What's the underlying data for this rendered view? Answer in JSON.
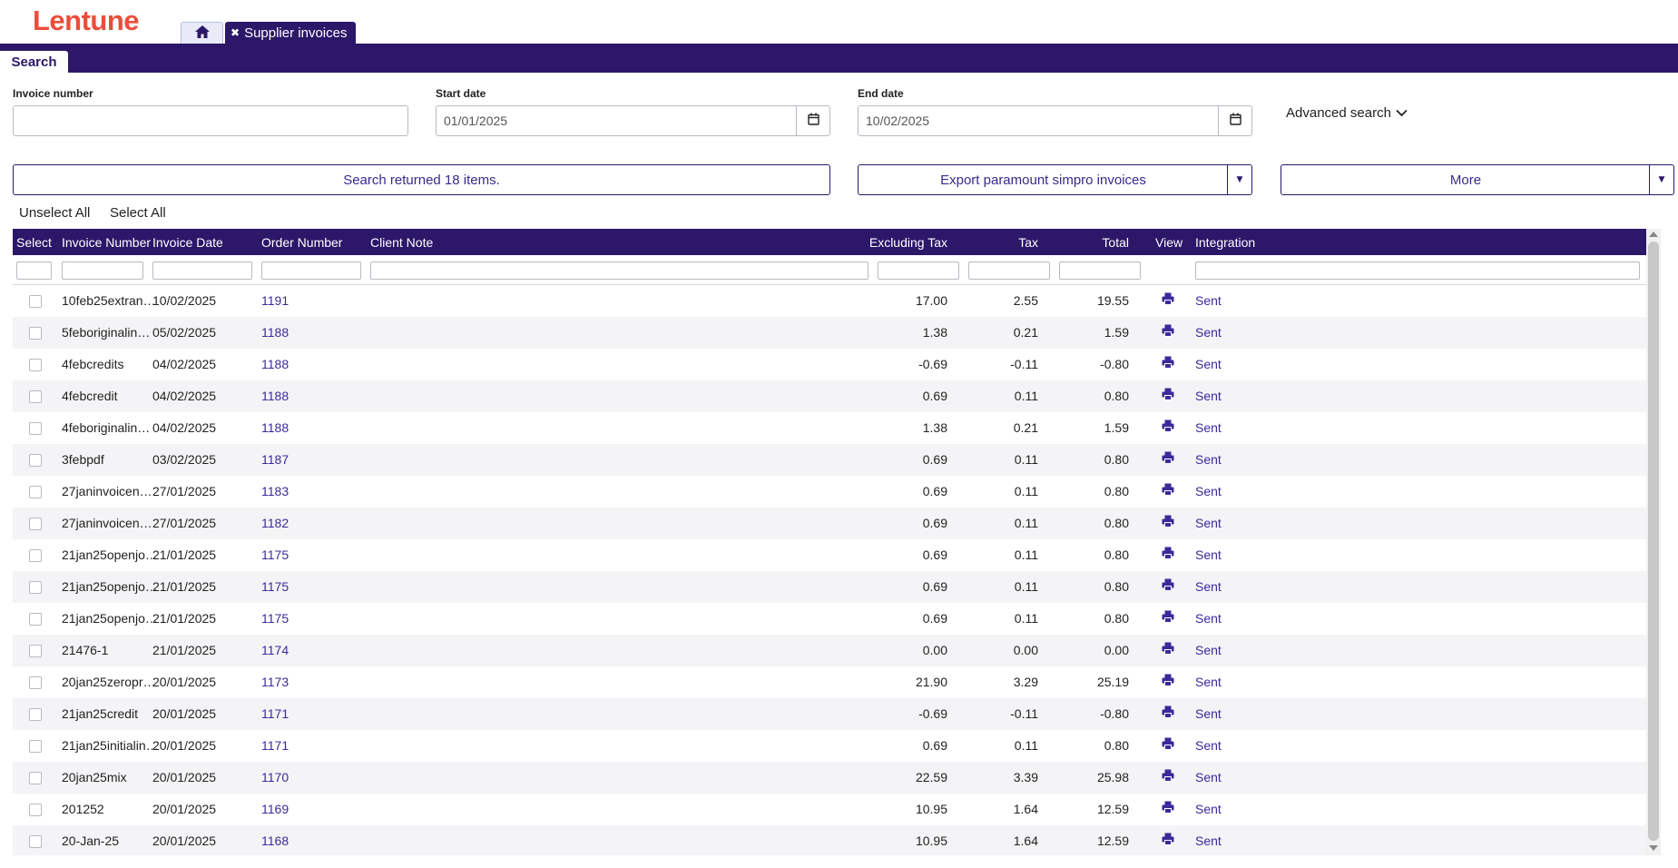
{
  "app": {
    "logo": "Lentune",
    "home_tab_icon": "home-icon",
    "active_tab": "Supplier invoices",
    "active_tab_close": "✖",
    "section_tab": "Search",
    "accent_color": "#2c1769",
    "logo_color": "#ec4d3a"
  },
  "filters": {
    "invoice_number_label": "Invoice number",
    "invoice_number_value": "",
    "start_date_label": "Start date",
    "start_date_value": "01/01/2025",
    "end_date_label": "End date",
    "end_date_value": "10/02/2025",
    "advanced_search": "Advanced search"
  },
  "actions": {
    "search_result": "Search returned 18 items.",
    "export": "Export paramount simpro invoices",
    "more": "More",
    "unselect_all": "Unselect All",
    "select_all": "Select All"
  },
  "grid": {
    "columns": [
      "Select",
      "Invoice Number",
      "Invoice Date",
      "Order Number",
      "Client Note",
      "Excluding Tax",
      "Tax",
      "Total",
      "View",
      "Integration"
    ],
    "rows": [
      {
        "invoice": "10feb25extran…",
        "date": "10/02/2025",
        "order": "1191",
        "note": "",
        "ex_tax": "17.00",
        "tax": "2.55",
        "total": "19.55",
        "integration": "Sent"
      },
      {
        "invoice": "5feboriginalin…",
        "date": "05/02/2025",
        "order": "1188",
        "note": "",
        "ex_tax": "1.38",
        "tax": "0.21",
        "total": "1.59",
        "integration": "Sent"
      },
      {
        "invoice": "4febcredits",
        "date": "04/02/2025",
        "order": "1188",
        "note": "",
        "ex_tax": "-0.69",
        "tax": "-0.11",
        "total": "-0.80",
        "integration": "Sent"
      },
      {
        "invoice": "4febcredit",
        "date": "04/02/2025",
        "order": "1188",
        "note": "",
        "ex_tax": "0.69",
        "tax": "0.11",
        "total": "0.80",
        "integration": "Sent"
      },
      {
        "invoice": "4feboriginalin…",
        "date": "04/02/2025",
        "order": "1188",
        "note": "",
        "ex_tax": "1.38",
        "tax": "0.21",
        "total": "1.59",
        "integration": "Sent"
      },
      {
        "invoice": "3febpdf",
        "date": "03/02/2025",
        "order": "1187",
        "note": "",
        "ex_tax": "0.69",
        "tax": "0.11",
        "total": "0.80",
        "integration": "Sent"
      },
      {
        "invoice": "27janinvoicen…",
        "date": "27/01/2025",
        "order": "1183",
        "note": "",
        "ex_tax": "0.69",
        "tax": "0.11",
        "total": "0.80",
        "integration": "Sent"
      },
      {
        "invoice": "27janinvoicen…",
        "date": "27/01/2025",
        "order": "1182",
        "note": "",
        "ex_tax": "0.69",
        "tax": "0.11",
        "total": "0.80",
        "integration": "Sent"
      },
      {
        "invoice": "21jan25openjo…",
        "date": "21/01/2025",
        "order": "1175",
        "note": "",
        "ex_tax": "0.69",
        "tax": "0.11",
        "total": "0.80",
        "integration": "Sent"
      },
      {
        "invoice": "21jan25openjo…",
        "date": "21/01/2025",
        "order": "1175",
        "note": "",
        "ex_tax": "0.69",
        "tax": "0.11",
        "total": "0.80",
        "integration": "Sent"
      },
      {
        "invoice": "21jan25openjo…",
        "date": "21/01/2025",
        "order": "1175",
        "note": "",
        "ex_tax": "0.69",
        "tax": "0.11",
        "total": "0.80",
        "integration": "Sent"
      },
      {
        "invoice": "21476-1",
        "date": "21/01/2025",
        "order": "1174",
        "note": "",
        "ex_tax": "0.00",
        "tax": "0.00",
        "total": "0.00",
        "integration": "Sent"
      },
      {
        "invoice": "20jan25zeropr…",
        "date": "20/01/2025",
        "order": "1173",
        "note": "",
        "ex_tax": "21.90",
        "tax": "3.29",
        "total": "25.19",
        "integration": "Sent"
      },
      {
        "invoice": "21jan25credit",
        "date": "20/01/2025",
        "order": "1171",
        "note": "",
        "ex_tax": "-0.69",
        "tax": "-0.11",
        "total": "-0.80",
        "integration": "Sent"
      },
      {
        "invoice": "21jan25initialin…",
        "date": "20/01/2025",
        "order": "1171",
        "note": "",
        "ex_tax": "0.69",
        "tax": "0.11",
        "total": "0.80",
        "integration": "Sent"
      },
      {
        "invoice": "20jan25mix",
        "date": "20/01/2025",
        "order": "1170",
        "note": "",
        "ex_tax": "22.59",
        "tax": "3.39",
        "total": "25.98",
        "integration": "Sent"
      },
      {
        "invoice": "201252",
        "date": "20/01/2025",
        "order": "1169",
        "note": "",
        "ex_tax": "10.95",
        "tax": "1.64",
        "total": "12.59",
        "integration": "Sent"
      },
      {
        "invoice": "20-Jan-25",
        "date": "20/01/2025",
        "order": "1168",
        "note": "",
        "ex_tax": "10.95",
        "tax": "1.64",
        "total": "12.59",
        "integration": "Sent"
      }
    ]
  }
}
